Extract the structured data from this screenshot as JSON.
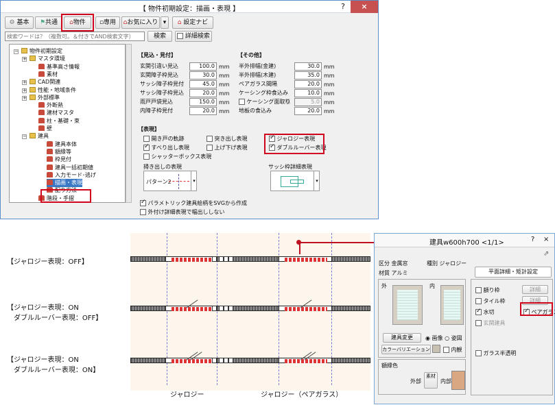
{
  "dialog": {
    "title": "【 物件初期設定：描画・表現 】",
    "help": "?",
    "close": "×"
  },
  "toolbar": {
    "basic": "基本",
    "common": "共通",
    "property": "物件",
    "exclusive": "専用",
    "favorites": "お気に入り",
    "nav": "設定ナビ"
  },
  "search": {
    "placeholder": "検索ワードは？（複数可。＆付きでAND検索文字）",
    "button": "検索",
    "detail": "詳細検索"
  },
  "tree": [
    {
      "label": "物件初期設定",
      "kind": "root",
      "pm": "−"
    },
    {
      "label": "マスタ環境",
      "kind": "folder",
      "pm": "+"
    },
    {
      "label": "基準高さ情報",
      "kind": "item"
    },
    {
      "label": "素材",
      "kind": "item"
    },
    {
      "label": "CAD関連",
      "kind": "folder",
      "pm": "+"
    },
    {
      "label": "性能・地域条件",
      "kind": "folder",
      "pm": "+"
    },
    {
      "label": "外部標準",
      "kind": "folder",
      "pm": "+"
    },
    {
      "label": "外断熱",
      "kind": "item"
    },
    {
      "label": "建材マスタ",
      "kind": "item"
    },
    {
      "label": "柱・基礎・束",
      "kind": "item"
    },
    {
      "label": "壁",
      "kind": "item"
    },
    {
      "label": "建具",
      "kind": "folder",
      "pm": "−"
    },
    {
      "label": "建具本体",
      "kind": "item"
    },
    {
      "label": "額縁等",
      "kind": "item"
    },
    {
      "label": "枠見付",
      "kind": "item"
    },
    {
      "label": "建具一括初期値",
      "kind": "item"
    },
    {
      "label": "入力モード･逃げ",
      "kind": "item"
    },
    {
      "label": "描画・表現",
      "kind": "item",
      "selected": true
    },
    {
      "label": "配り方法",
      "kind": "item"
    },
    {
      "label": "階段・手摺",
      "kind": "item"
    }
  ],
  "mikomi": {
    "header": "【見込・見付】",
    "unit": "mm",
    "rows": [
      {
        "label": "玄関引違い見込",
        "value": "100.0"
      },
      {
        "label": "玄関障子枠見込",
        "value": "30.0"
      },
      {
        "label": "サッシ障子枠見付",
        "value": "45.0"
      },
      {
        "label": "サッシ障子枠見込",
        "value": "20.0"
      },
      {
        "label": "雨戸戸袋見込",
        "value": "150.0"
      },
      {
        "label": "内障子枠見付",
        "value": "20.0"
      }
    ]
  },
  "other": {
    "header": "【その他】",
    "unit": "mm",
    "rows": [
      {
        "label": "半外排幅(金建)",
        "value": "30.0"
      },
      {
        "label": "半外排幅(木建)",
        "value": "35.0"
      },
      {
        "label": "ペアガラス間隔",
        "value": "20.0"
      },
      {
        "label": "ケーシング枠食込み",
        "value": "10.0"
      },
      {
        "label": "ケーシング面取り",
        "value": "5.0",
        "disabledLabel": "幅"
      },
      {
        "label": "地板の食込み",
        "value": "20.0"
      }
    ]
  },
  "hyogen": {
    "header": "【表現】",
    "checks": [
      {
        "label": "開き戸の軌跡",
        "checked": false
      },
      {
        "label": "すべり出し表現",
        "checked": true
      },
      {
        "label": "シャッターボックス表現",
        "checked": false
      },
      {
        "label": "突き出し表現",
        "checked": false
      },
      {
        "label": "上げ下げ表現",
        "checked": false
      },
      {
        "label": "ジャロジー表現",
        "checked": true
      },
      {
        "label": "ダブルルーバー表現",
        "checked": true
      }
    ],
    "slideLabel": "掃き出しの表現",
    "pattern": "パターン2",
    "sashLabel": "サッシ枠詳細表現",
    "svg": "パラメトリック建具絵柄をSVGから作成",
    "outer": "外付け詳細表現で幅出ししない"
  },
  "captions": {
    "off": "【ジャロジー表現：OFF】",
    "on1a": "【ジャロジー表現：ON",
    "on1b": "ダブルルーバー表現：OFF】",
    "on2a": "【ジャロジー表現：ON",
    "on2b": "ダブルルーバー表現：ON】",
    "jalousie": "ジャロジー",
    "jalousiePair": "ジャロジー（ペアガラス）"
  },
  "panel": {
    "title": "建具w600h700  <1/1>",
    "help": "?",
    "close": "×",
    "kubunLabel": "区分",
    "kubun": "金属窓",
    "shubetsuLabel": "種別",
    "shubetsu": "ジャロジー",
    "zaishitsuLabel": "材質",
    "zaishitsu": "アルミ",
    "tab": "平面詳細・矩計設定",
    "outLabel": "外",
    "inLabel": "内",
    "change": "建具変更",
    "image": "画像",
    "fig": "姿図",
    "variation": "カラーバリエーション",
    "inview": "内観",
    "frameColor": "額縁色",
    "outside": "外部",
    "material": "素材",
    "inside": "内部",
    "checks": [
      {
        "label": "額り枠",
        "checked": false,
        "btn": "詳細"
      },
      {
        "label": "タイル枠",
        "checked": false,
        "btn": "詳細"
      },
      {
        "label": "水切",
        "checked": true
      },
      {
        "label": "ペアガラス",
        "checked": true
      },
      {
        "label": "玄関建具",
        "checked": false
      },
      {
        "label": "ガラス半透明",
        "checked": false
      }
    ]
  }
}
